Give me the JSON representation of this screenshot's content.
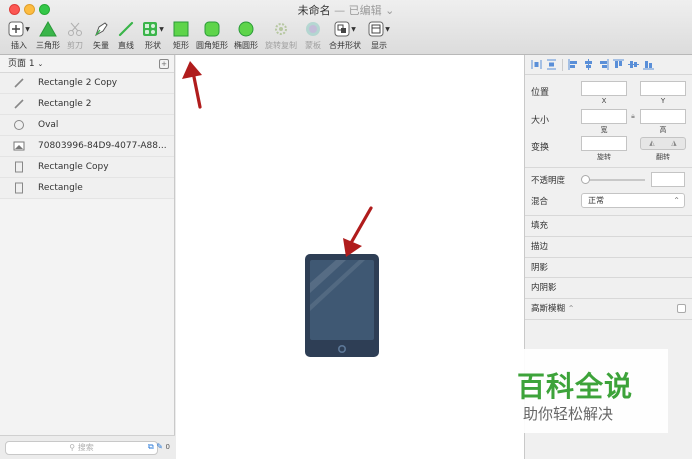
{
  "window": {
    "title": "未命名",
    "separator": "—",
    "status": "已编辑"
  },
  "toolbar": {
    "items": [
      {
        "label": "插入",
        "icon": "plus-icon",
        "has_menu": true
      },
      {
        "label": "三角形",
        "icon": "triangle-icon"
      },
      {
        "label": "剪刀",
        "icon": "scissors-icon",
        "disabled": true
      },
      {
        "label": "矢量",
        "icon": "pen-icon"
      },
      {
        "label": "直线",
        "icon": "line-icon"
      },
      {
        "label": "形状",
        "icon": "shapes-icon",
        "has_menu": true
      },
      {
        "label": "矩形",
        "icon": "rectangle-icon"
      },
      {
        "label": "圆角矩形",
        "icon": "rounded-rectangle-icon"
      },
      {
        "label": "椭圆形",
        "icon": "oval-icon"
      },
      {
        "label": "旋转复制",
        "icon": "rotate-copy-icon",
        "disabled": true
      },
      {
        "label": "蒙板",
        "icon": "mask-icon",
        "disabled": true
      },
      {
        "label": "合并形状",
        "icon": "combine-shapes-icon",
        "has_menu": true
      },
      {
        "label": "显示",
        "icon": "view-icon",
        "has_menu": true
      }
    ]
  },
  "pages": {
    "current": "页面 1"
  },
  "layers": [
    {
      "name": "Rectangle 2 Copy",
      "icon": "line-layer-icon"
    },
    {
      "name": "Rectangle 2",
      "icon": "line-layer-icon"
    },
    {
      "name": "Oval",
      "icon": "oval-layer-icon"
    },
    {
      "name": "70803996-84D9-4077-A88...",
      "icon": "image-layer-icon"
    },
    {
      "name": "Rectangle Copy",
      "icon": "rectangle-layer-icon"
    },
    {
      "name": "Rectangle",
      "icon": "rectangle-layer-icon"
    }
  ],
  "search": {
    "placeholder": "搜索",
    "count": "0"
  },
  "inspector": {
    "position_label": "位置",
    "x_label": "X",
    "y_label": "Y",
    "size_label": "大小",
    "width_label": "宽",
    "height_label": "高",
    "transform_label": "变换",
    "rotate_label": "旋转",
    "flip_label": "翻转",
    "opacity_label": "不透明度",
    "blend_label": "混合",
    "blend_value": "正常",
    "fill_label": "填充",
    "border_label": "描边",
    "shadow_label": "阴影",
    "inner_shadow_label": "内阴影",
    "blur_label": "高斯模糊"
  },
  "watermark": {
    "title": "百科全说",
    "subtitle": "助你轻松解决"
  },
  "colors": {
    "accent_green": "#3ab54a",
    "arrow_red": "#b01c1c",
    "tablet_body": "#2e3e55",
    "tablet_screen": "#3f5873"
  }
}
